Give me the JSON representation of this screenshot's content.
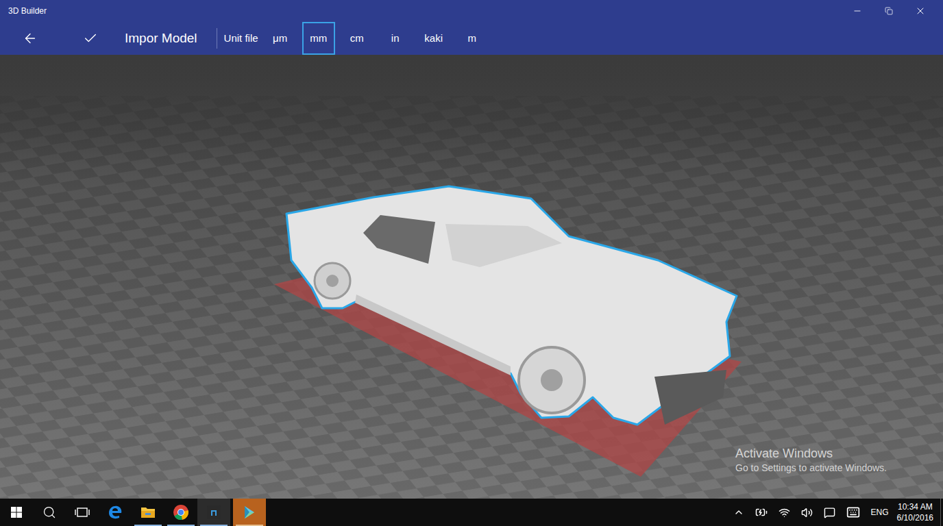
{
  "window": {
    "title": "3D Builder"
  },
  "toolbar": {
    "title": "Impor Model",
    "unit_label": "Unit file",
    "units": [
      {
        "label": "μm",
        "selected": false
      },
      {
        "label": "mm",
        "selected": true
      },
      {
        "label": "cm",
        "selected": false
      },
      {
        "label": "in",
        "selected": false
      },
      {
        "label": "kaki",
        "selected": false
      },
      {
        "label": "m",
        "selected": false
      }
    ]
  },
  "viewport": {
    "model_selected": true
  },
  "watermark": {
    "title": "Activate Windows",
    "subtitle": "Go to Settings to activate Windows."
  },
  "taskbar": {
    "apps": [
      {
        "kind": "search",
        "running": false,
        "selected": false
      },
      {
        "kind": "taskview",
        "running": false,
        "selected": false
      },
      {
        "kind": "edge",
        "running": false,
        "selected": false
      },
      {
        "kind": "explorer",
        "running": true,
        "selected": false
      },
      {
        "kind": "chrome",
        "running": true,
        "selected": false
      },
      {
        "kind": "app",
        "running": true,
        "selected": false
      },
      {
        "kind": "builder",
        "running": true,
        "selected": true
      }
    ],
    "tray": {
      "language": "ENG",
      "time": "10:34 AM",
      "date": "6/10/2016"
    }
  }
}
